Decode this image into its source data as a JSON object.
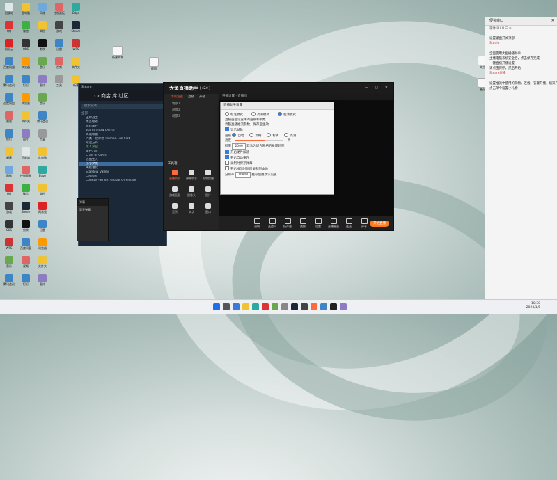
{
  "desktop": {
    "icons": [
      {
        "label": "回收站",
        "color": "#e0e6ea"
      },
      {
        "label": "此电脑",
        "color": "#f1c232"
      },
      {
        "label": "网络",
        "color": "#6fa8dc"
      },
      {
        "label": "控制面板",
        "color": "#e06666"
      },
      {
        "label": "Edge",
        "color": "#2fa8a0"
      },
      {
        "label": "QQ",
        "color": "#d33"
      },
      {
        "label": "微信",
        "color": "#3cb043"
      },
      {
        "label": "文档",
        "color": "#f1c232"
      },
      {
        "label": "游戏",
        "color": "#444"
      },
      {
        "label": "Steam",
        "color": "#1b2838"
      },
      {
        "label": "网易云",
        "color": "#d22"
      },
      {
        "label": "OBS",
        "color": "#333"
      },
      {
        "label": "剪映",
        "color": "#111"
      },
      {
        "label": "迅雷",
        "color": "#3d85c6"
      },
      {
        "label": "WPS",
        "color": "#c33"
      },
      {
        "label": "百度网盘",
        "color": "#3d85c6"
      },
      {
        "label": "浏览器",
        "color": "#f90"
      },
      {
        "label": "音乐",
        "color": "#6aa84f"
      },
      {
        "label": "视频",
        "color": "#e06666"
      },
      {
        "label": "文件夹",
        "color": "#f1c232"
      },
      {
        "label": "腾讯会议",
        "color": "#3d85c6"
      },
      {
        "label": "钉钉",
        "color": "#3d85c6"
      },
      {
        "label": "图片",
        "color": "#8e7cc3"
      },
      {
        "label": "工具",
        "color": "#999"
      },
      {
        "label": "新建",
        "color": "#f1c232"
      }
    ],
    "file_icons": [
      {
        "label": "新建文本"
      },
      {
        "label": "截图"
      },
      {
        "label": "文档"
      },
      {
        "label": "备份"
      }
    ]
  },
  "notes": {
    "title": "便签窗口",
    "close": "✕",
    "toolbar": "字体  B  I  U  ☰  ≡",
    "lines": [
      {
        "text": "设置输出开关顶部",
        "red": ""
      },
      {
        "text": "",
        "red": "Studio"
      },
      {
        "text": "全面使用大鱼播播助手",
        "red": ""
      },
      {
        "text": "主播电脑系统安全后，点击保存完成",
        "red": ""
      },
      {
        "text": "一键直播开播设置",
        "red": ""
      },
      {
        "text": "请点击保存，然后开始",
        "red": ""
      },
      {
        "text": "",
        "red": "Steam直播"
      },
      {
        "text": "设置推流中使用的礼物，连线，答疑开播，结束开播",
        "red": ""
      },
      {
        "text": "点击单个设置小礼物",
        "red": ""
      }
    ]
  },
  "steam": {
    "title": "Steam",
    "nav": "‹ › 商店 库 社区",
    "search": "搜索游戏",
    "header": "全部",
    "games": [
      {
        "name": "王牌战士",
        "state": ""
      },
      {
        "name": "太吾绘卷",
        "state": ""
      },
      {
        "name": "游戏库存",
        "state": ""
      },
      {
        "name": "Warm Snow Demo",
        "state": ""
      },
      {
        "name": "英雄联盟",
        "state": ""
      },
      {
        "name": "人类一败涂地 Human Fall Flat",
        "state": ""
      },
      {
        "name": "命运方舟",
        "state": ""
      },
      {
        "name": "无人深空",
        "state": "run"
      },
      {
        "name": "鬼谷八荒",
        "state": ""
      },
      {
        "name": "Craft of Gods",
        "state": ""
      },
      {
        "name": "逃出生天",
        "state": ""
      },
      {
        "name": "小小梦魇",
        "state": "sel"
      },
      {
        "name": "失控进化",
        "state": ""
      },
      {
        "name": "Stardew Valley",
        "state": ""
      },
      {
        "name": "Celeste",
        "state": ""
      },
      {
        "name": "Counter-Strike: Global Offensive",
        "state": ""
      }
    ]
  },
  "app": {
    "logo": "大鱼直播助手",
    "version": "v2.0",
    "window_controls": "— ▢ ✕",
    "tabs": [
      {
        "label": "场景设置",
        "on": true
      },
      {
        "label": "直播",
        "on": false
      },
      {
        "label": "开播",
        "on": false
      }
    ],
    "scenes": [
      "场景1",
      "场景2",
      "场景3"
    ],
    "tools_title": "工具箱",
    "tools": [
      {
        "label": "直播助手",
        "hot": true
      },
      {
        "label": "弹幕助手",
        "hot": false
      },
      {
        "label": "礼物提醒",
        "hot": false
      },
      {
        "label": "游戏画面",
        "hot": false
      },
      {
        "label": "摄像头",
        "hot": false
      },
      {
        "label": "图片",
        "hot": false
      },
      {
        "label": "音乐",
        "hot": false
      },
      {
        "label": "文字",
        "hot": false
      },
      {
        "label": "窗口",
        "hot": false
      }
    ],
    "right_tabs": "开播设置 · 直播间",
    "bottom_buttons": [
      "录制",
      "麦克风",
      "扬声器",
      "美颜",
      "设置",
      "直播画面",
      "连麦",
      "分享"
    ],
    "go_live": "开始直播"
  },
  "dialog": {
    "title": "直播助手设置",
    "mode_options": [
      {
        "label": "标准模式",
        "on": false
      },
      {
        "label": "高清模式",
        "on": false
      },
      {
        "label": "超清模式",
        "on": true
      }
    ],
    "desc1": "直播画面设置中的画质和帧数",
    "desc2": "调整直播推流参数，保存后生效",
    "show_fps": "显示帧数",
    "quality_label": "画质",
    "quality_opts": [
      {
        "label": "自动",
        "on": true
      },
      {
        "label": "流畅",
        "on": false
      },
      {
        "label": "标清",
        "on": false
      },
      {
        "label": "高清",
        "on": false
      }
    ],
    "brightness_label": "亮度",
    "brightness_level": 0.62,
    "brightness_high": "高",
    "bitrate_label": "码率",
    "bitrate_value": "2000",
    "bitrate_hint": "默认为适合网络的推荐码率",
    "opt1": "开启硬件加速",
    "opt2": "开启自动重连",
    "opt3": "录制时保存弹幕",
    "opt4": "开启推流时同时录制到本地",
    "resolution_label": "分辨率",
    "resolution_value": "1080P",
    "resolution_hint": "推荐使用默认设置"
  },
  "mini": {
    "title": "弹幕",
    "line": "暂无弹幕"
  },
  "taskbar": {
    "time": "10:30",
    "date": "2023/1/5"
  }
}
